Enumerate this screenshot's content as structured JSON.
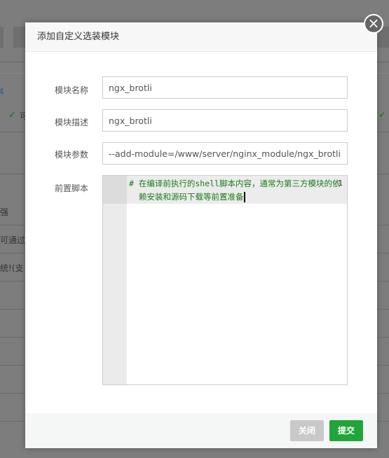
{
  "background": {
    "fragments": [
      "4",
      "可",
      "强",
      "可通过",
      "统!(支"
    ]
  },
  "dialog": {
    "title": "添加自定义选装模块",
    "fields": [
      {
        "label": "模块名称",
        "value": "ngx_brotli"
      },
      {
        "label": "模块描述",
        "value": "ngx_brotli"
      },
      {
        "label": "模块参数",
        "value": "--add-module=/www/server/nginx_module/ngx_brotli"
      }
    ],
    "script": {
      "label": "前置脚本",
      "line_number": "1",
      "code": "# 在编译前执行的shell脚本内容，通常为第三方模块的依赖安装和源码下载等前置准备"
    },
    "buttons": {
      "close": "关闭",
      "submit": "提交"
    }
  },
  "colors": {
    "submit": "#20a53a",
    "close_disabled": "#c9c9c9",
    "code": "#1a7a1a"
  }
}
